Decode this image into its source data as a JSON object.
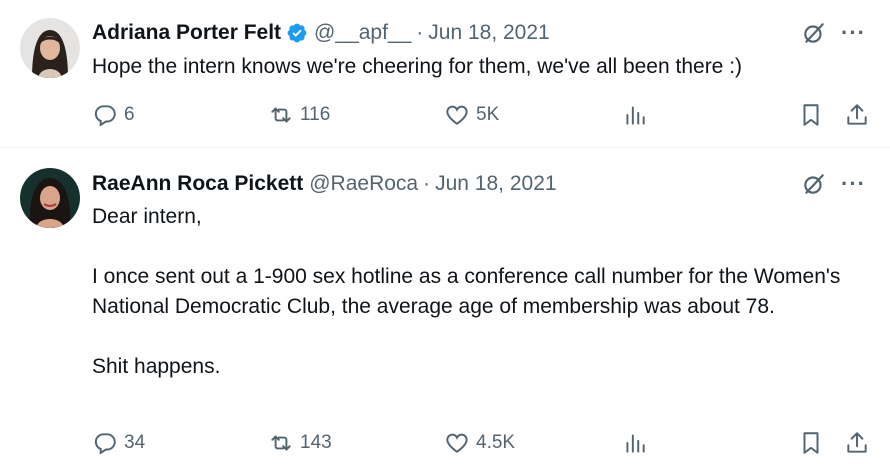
{
  "tweets": [
    {
      "display_name": "Adriana Porter Felt",
      "verified": true,
      "handle": "@__apf__",
      "separator": "·",
      "date": "Jun 18, 2021",
      "body": [
        "Hope the intern knows we're cheering for them, we've all been there :)"
      ],
      "replies": "6",
      "retweets": "116",
      "likes": "5K"
    },
    {
      "display_name": "RaeAnn Roca Pickett",
      "verified": false,
      "handle": "@RaeRoca",
      "separator": "·",
      "date": "Jun 18, 2021",
      "body": [
        "Dear intern,",
        "I once sent out a 1-900 sex hotline as a conference call number for the Women's National Democratic Club, the average age of membership was about 78.",
        "Shit happens."
      ],
      "replies": "34",
      "retweets": "143",
      "likes": "4.5K"
    }
  ],
  "icons": {
    "more": "···",
    "verified_color": "#1d9bf0",
    "muted_color": "#536471"
  }
}
